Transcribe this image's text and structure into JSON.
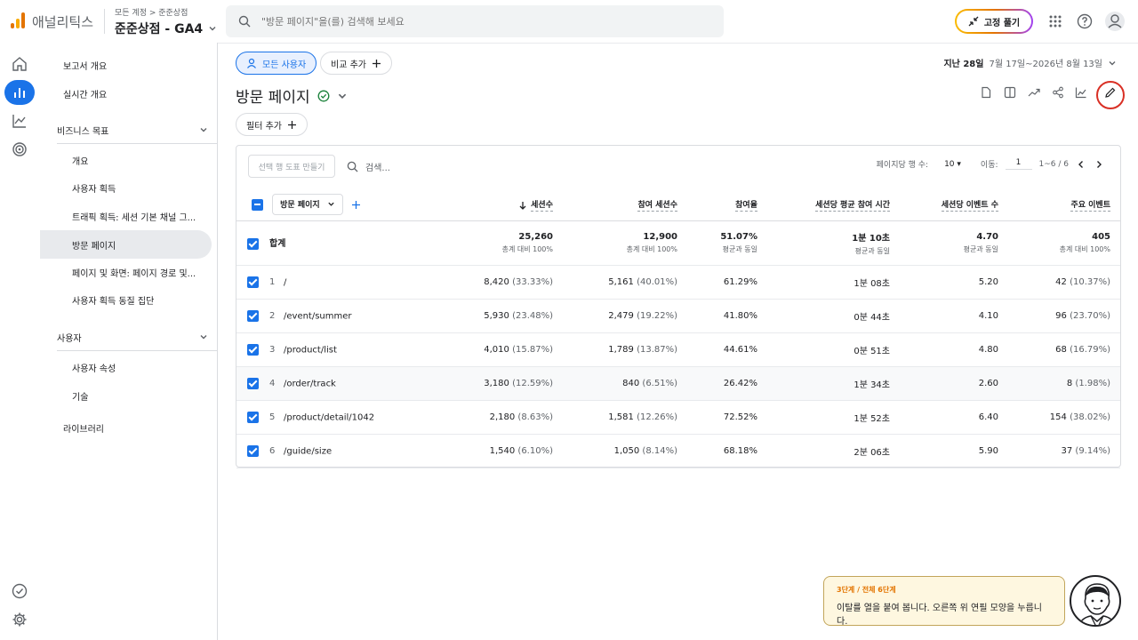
{
  "app": {
    "name": "애널리틱스",
    "breadcrumb": "모든 계정 > 준준상점",
    "property": "준준상점 - GA4",
    "search_placeholder": "\"방문 페이지\"을(를) 검색해 보세요",
    "pin_label": "고정 풀기"
  },
  "sidebar": {
    "items": [
      {
        "label": "보고서 개요"
      },
      {
        "label": "실시간 개요"
      }
    ],
    "section_business": "비즈니스 목표",
    "business_items": [
      {
        "label": "개요"
      },
      {
        "label": "사용자 획득"
      },
      {
        "label": "트래픽 획득: 세션 기본 채널 그..."
      },
      {
        "label": "방문 페이지"
      },
      {
        "label": "페이지 및 화면: 페이지 경로 및..."
      },
      {
        "label": "사용자 획득 동질 집단"
      }
    ],
    "section_user": "사용자",
    "user_items": [
      {
        "label": "사용자 속성"
      },
      {
        "label": "기술"
      }
    ],
    "library": "라이브러리"
  },
  "main": {
    "audience_chip": "모든 사용자",
    "compare_chip": "비교 추가",
    "title": "방문 페이지",
    "filter_chip": "필터 추가",
    "date_label": "지난 28일",
    "date_range": "7월 17일~2026년 8월 13일"
  },
  "table": {
    "make_segment": "선택 행 도표 만들기",
    "search_placeholder": "검색...",
    "rows_per_page_label": "페이지당 행 수:",
    "rows_per_page": "10",
    "goto_label": "이동:",
    "goto_value": "1",
    "range": "1~6 / 6",
    "dimension": "방문 페이지",
    "headers": [
      "세션수",
      "참여 세션수",
      "참여율",
      "세션당 평균 참여 시간",
      "세션당 이벤트 수",
      "주요 이벤트"
    ],
    "total": {
      "label": "합계",
      "values": [
        "25,260",
        "12,900",
        "51.07%",
        "1분 10초",
        "4.70",
        "405"
      ],
      "subs": [
        "총계 대비 100%",
        "총계 대비 100%",
        "평균과 동일",
        "평균과 동일",
        "평균과 동일",
        "총계 대비 100%"
      ]
    },
    "rows": [
      {
        "no": "1",
        "page": "/",
        "sessions": "8,420",
        "sessions_pct": "(33.33%)",
        "engaged": "5,161",
        "engaged_pct": "(40.01%)",
        "rate": "61.29%",
        "time": "1분 08초",
        "events": "5.20",
        "key": "42",
        "key_pct": "(10.37%)"
      },
      {
        "no": "2",
        "page": "/event/summer",
        "sessions": "5,930",
        "sessions_pct": "(23.48%)",
        "engaged": "2,479",
        "engaged_pct": "(19.22%)",
        "rate": "41.80%",
        "time": "0분 44초",
        "events": "4.10",
        "key": "96",
        "key_pct": "(23.70%)"
      },
      {
        "no": "3",
        "page": "/product/list",
        "sessions": "4,010",
        "sessions_pct": "(15.87%)",
        "engaged": "1,789",
        "engaged_pct": "(13.87%)",
        "rate": "44.61%",
        "time": "0분 51초",
        "events": "4.80",
        "key": "68",
        "key_pct": "(16.79%)"
      },
      {
        "no": "4",
        "page": "/order/track",
        "sessions": "3,180",
        "sessions_pct": "(12.59%)",
        "engaged": "840",
        "engaged_pct": "(6.51%)",
        "rate": "26.42%",
        "time": "1분 34초",
        "events": "2.60",
        "key": "8",
        "key_pct": "(1.98%)"
      },
      {
        "no": "5",
        "page": "/product/detail/1042",
        "sessions": "2,180",
        "sessions_pct": "(8.63%)",
        "engaged": "1,581",
        "engaged_pct": "(12.26%)",
        "rate": "72.52%",
        "time": "1분 52초",
        "events": "6.40",
        "key": "154",
        "key_pct": "(38.02%)"
      },
      {
        "no": "6",
        "page": "/guide/size",
        "sessions": "1,540",
        "sessions_pct": "(6.10%)",
        "engaged": "1,050",
        "engaged_pct": "(8.14%)",
        "rate": "68.18%",
        "time": "2분 06초",
        "events": "5.90",
        "key": "37",
        "key_pct": "(9.14%)"
      }
    ]
  },
  "tooltip": {
    "step": "3단계 / 전체 6단계",
    "message": "이탈를 열을 붙여 봅니다. 오른쪽 위 연필 모양을 누릅니다."
  },
  "colors": {
    "accent": "#1a73e8",
    "highlight_ring": "#d93025",
    "tip_bg": "#fef7e0",
    "tip_step": "#e37400"
  }
}
